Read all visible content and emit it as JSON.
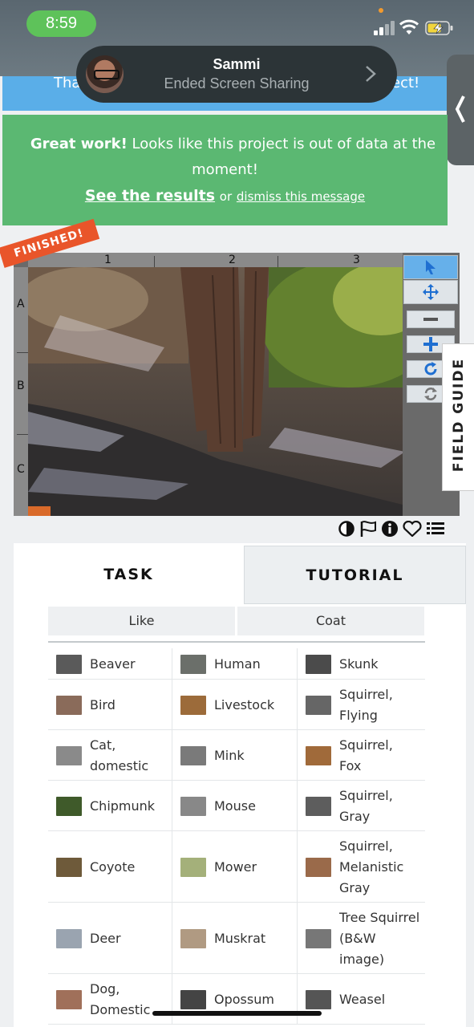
{
  "status_bar": {
    "time": "8:59"
  },
  "screen_share": {
    "name": "Sammi",
    "status": "Ended Screen Sharing"
  },
  "blue_message": {
    "left_fragment": "Tha",
    "right_fragment": "ect!"
  },
  "completion_message": {
    "strong": "Great work!",
    "text": "Looks like this project is out of data at the moment!",
    "line2": "moment!",
    "results_link": "See the results",
    "or": "or",
    "dismiss_link": "dismiss this message"
  },
  "viewer": {
    "columns": [
      "1",
      "2",
      "3"
    ],
    "rows": [
      "A",
      "B",
      "C"
    ],
    "badge": "FINISHED!",
    "field_guide": "FIELD GUIDE",
    "tools": [
      "pointer-icon",
      "move-icon",
      "zoom-out-icon",
      "zoom-in-icon",
      "rotate-icon",
      "reset-icon"
    ],
    "meta_icons": [
      "contrast-icon",
      "flag-icon",
      "info-icon",
      "heart-icon",
      "list-icon"
    ]
  },
  "tabs": {
    "task": "TASK",
    "tutorial": "TUTORIAL"
  },
  "filters": {
    "like": "Like",
    "coat": "Coat"
  },
  "species": [
    {
      "label": "Beaver",
      "color": "#5a5a5a"
    },
    {
      "label": "Human",
      "color": "#6b6f6a"
    },
    {
      "label": "Skunk",
      "color": "#4b4b4b"
    },
    {
      "label": "Bird",
      "color": "#8a6b5a"
    },
    {
      "label": "Livestock",
      "color": "#9c6b3a"
    },
    {
      "label": "Squirrel,\nFlying",
      "color": "#666"
    },
    {
      "label": "Cat,\ndomestic",
      "color": "#8a8a8a"
    },
    {
      "label": "Mink",
      "color": "#7a7a7a"
    },
    {
      "label": "Squirrel,\nFox",
      "color": "#a06a3a"
    },
    {
      "label": "Chipmunk",
      "color": "#3f5a2a"
    },
    {
      "label": "Mouse",
      "color": "#888"
    },
    {
      "label": "Squirrel,\nGray",
      "color": "#5d5d5d"
    },
    {
      "label": "Coyote",
      "color": "#6e5a3a"
    },
    {
      "label": "Mower",
      "color": "#a4b07a"
    },
    {
      "label": "Squirrel,\nMelanistic\nGray",
      "color": "#9a6a4a"
    },
    {
      "label": "Deer",
      "color": "#9aa4b0"
    },
    {
      "label": "Muskrat",
      "color": "#b09a82"
    },
    {
      "label": "Tree Squirrel\n(B&W\nimage)",
      "color": "#777"
    },
    {
      "label": "Dog,\nDomestic",
      "color": "#a0705a"
    },
    {
      "label": "Opossum",
      "color": "#444"
    },
    {
      "label": "Weasel",
      "color": "#555"
    }
  ]
}
